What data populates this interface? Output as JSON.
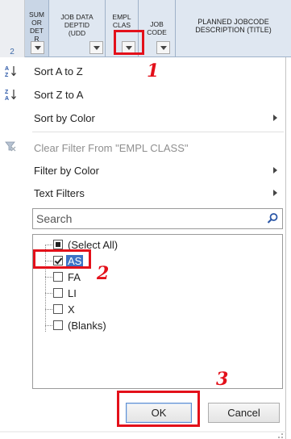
{
  "sheet": {
    "row_number": "2",
    "columns": [
      {
        "text": "SUM\nOR\nDET\nR"
      },
      {
        "text": "JOB DATA\nDEPTID\n(UDD"
      },
      {
        "text": "EMPL\nCLAS"
      },
      {
        "text": "JOB\nCODE"
      },
      {
        "text": "PLANNED JOBCODE\nDESCRIPTION (TITLE)"
      }
    ]
  },
  "menu": {
    "sort_az": "Sort A to Z",
    "sort_za": "Sort Z to A",
    "sort_by_color": "Sort by Color",
    "clear_filter": "Clear Filter From \"EMPL CLASS\"",
    "filter_by_color": "Filter by Color",
    "text_filters": "Text Filters",
    "sort_az_icon": "A Z",
    "sort_za_icon": "Z A"
  },
  "search": {
    "placeholder": "Search"
  },
  "filter_list": {
    "items": [
      {
        "label": "(Select All)",
        "state": "partial"
      },
      {
        "label": "AS",
        "state": "checked",
        "highlighted": true
      },
      {
        "label": "FA",
        "state": "unchecked"
      },
      {
        "label": "LI",
        "state": "unchecked"
      },
      {
        "label": "X",
        "state": "unchecked"
      },
      {
        "label": "(Blanks)",
        "state": "unchecked"
      }
    ]
  },
  "buttons": {
    "ok": "OK",
    "cancel": "Cancel"
  },
  "annotations": {
    "step1": "1",
    "step2": "2",
    "step3": "3",
    "color": "#e3101a"
  },
  "icons": {
    "sort_az": "sort-ascending-icon",
    "sort_za": "sort-descending-icon",
    "clear_filter": "clear-filter-icon",
    "search": "magnifier-icon",
    "submenu": "submenu-arrow-icon"
  }
}
